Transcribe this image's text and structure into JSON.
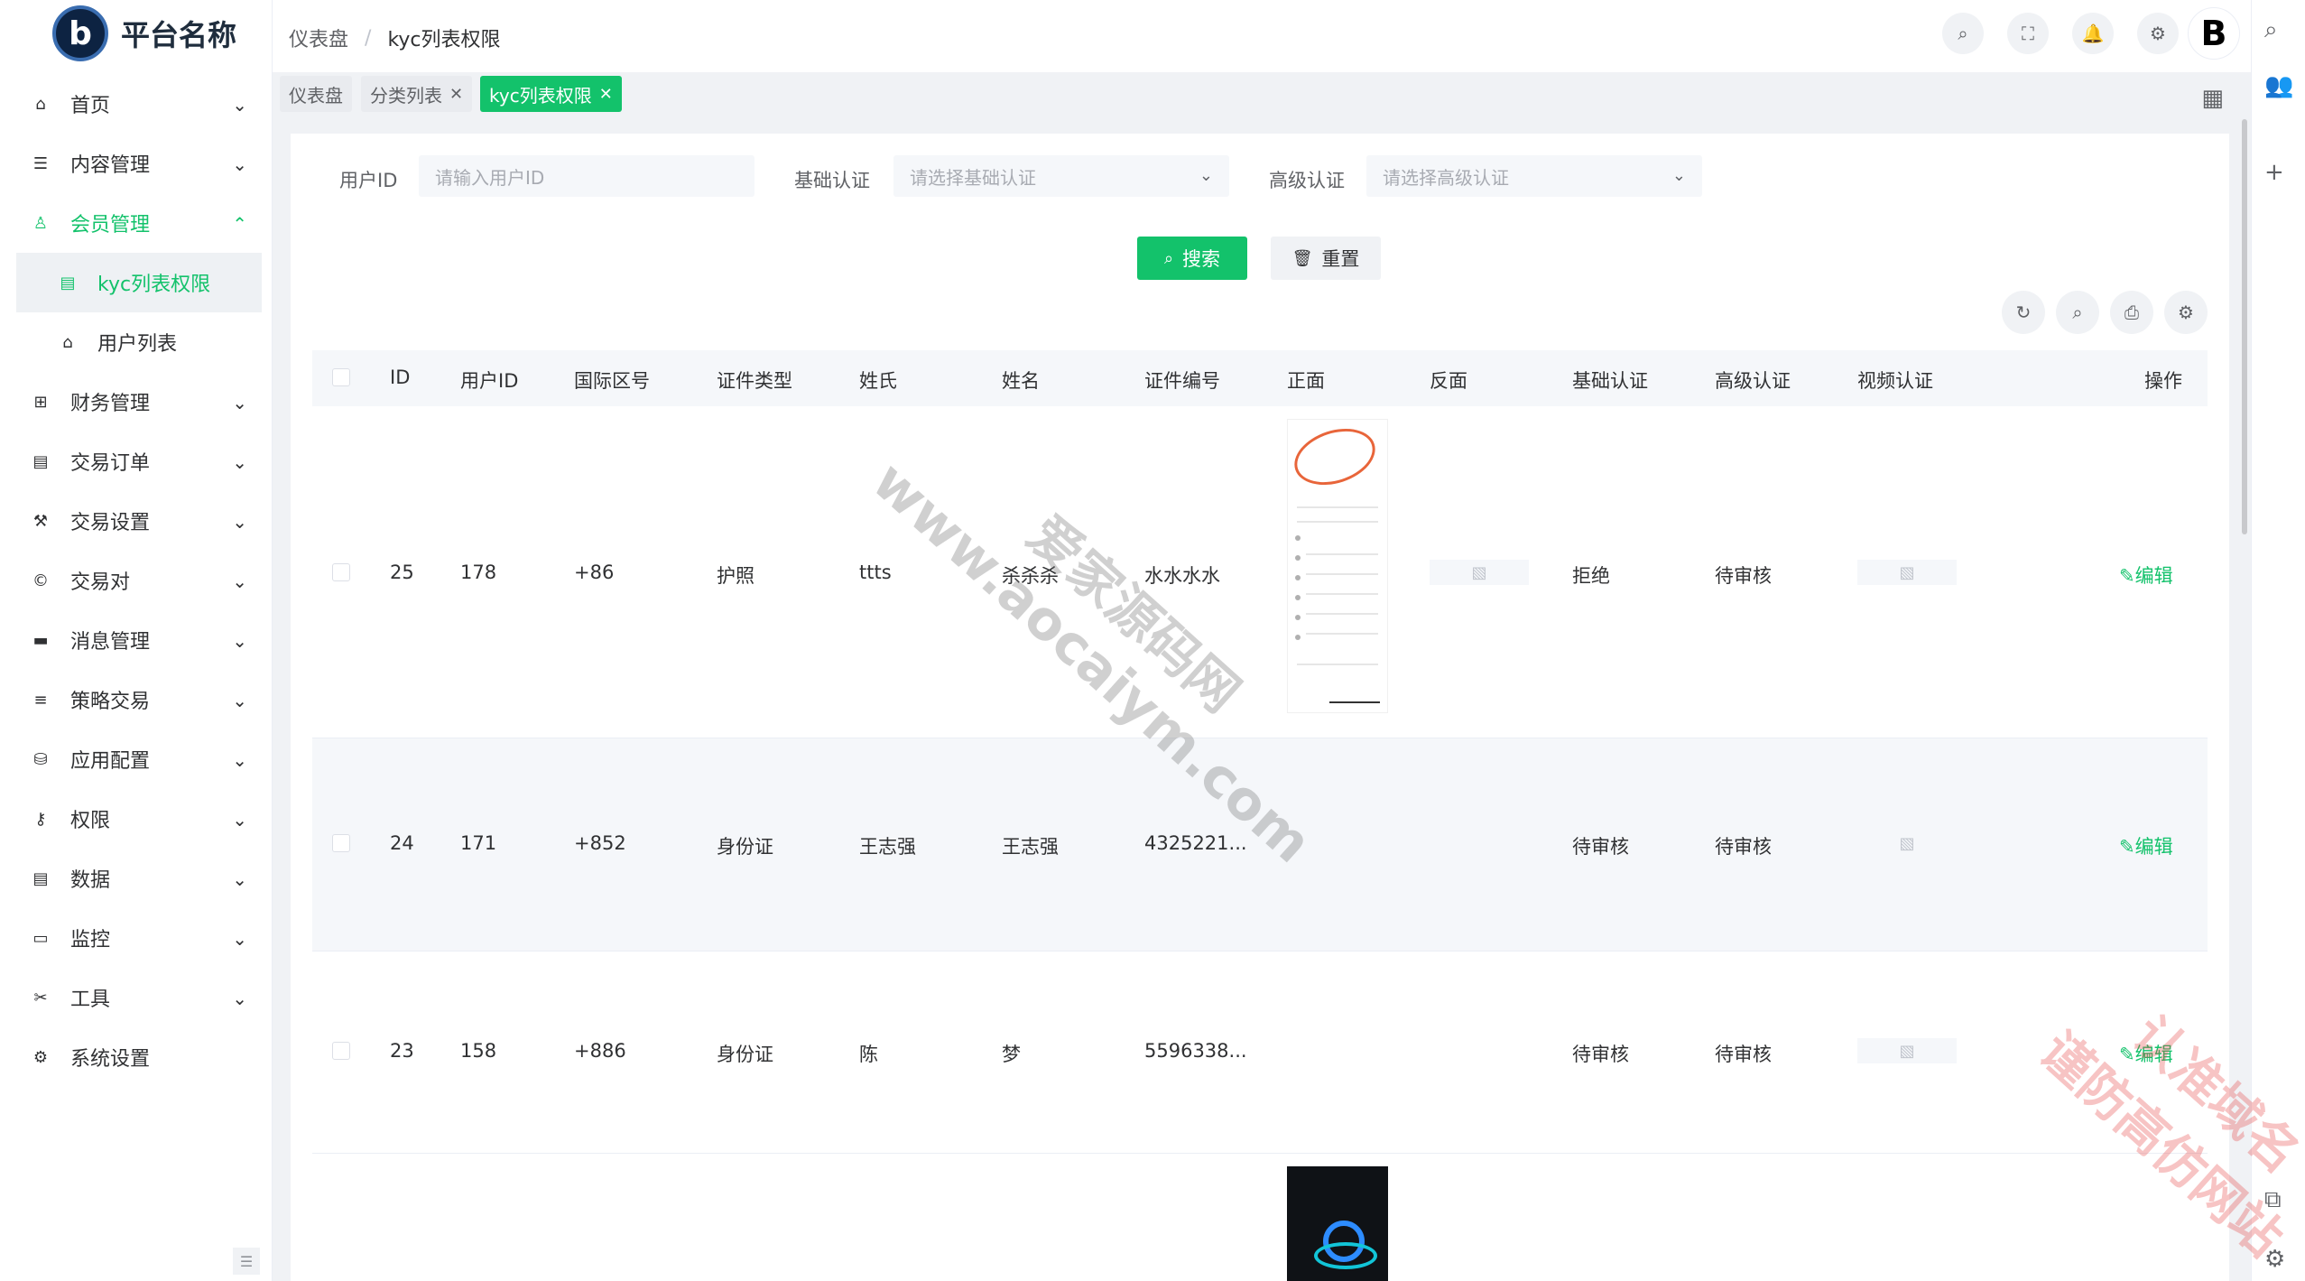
{
  "app": {
    "title": "平台名称",
    "logo_letter": "b"
  },
  "breadcrumb": [
    "仪表盘",
    "kyc列表权限"
  ],
  "sidebar": {
    "items": [
      {
        "label": "首页",
        "icon": "home-icon",
        "glyph": "⌂",
        "arrow": "⌄"
      },
      {
        "label": "内容管理",
        "icon": "list-icon",
        "glyph": "☰",
        "arrow": "⌄"
      },
      {
        "label": "会员管理",
        "icon": "user-icon",
        "glyph": "♙",
        "arrow": "⌃",
        "open": true
      },
      {
        "label": "kyc列表权限",
        "icon": "book-icon",
        "glyph": "▤",
        "sub": true,
        "active": true
      },
      {
        "label": "用户列表",
        "icon": "home-icon",
        "glyph": "⌂",
        "sub": true
      },
      {
        "label": "财务管理",
        "icon": "grid-icon",
        "glyph": "⊞",
        "arrow": "⌄"
      },
      {
        "label": "交易订单",
        "icon": "table-icon",
        "glyph": "▤",
        "arrow": "⌄"
      },
      {
        "label": "交易设置",
        "icon": "wrench-icon",
        "glyph": "⚒",
        "arrow": "⌄"
      },
      {
        "label": "交易对",
        "icon": "copyright-icon",
        "glyph": "©",
        "arrow": "⌄"
      },
      {
        "label": "消息管理",
        "icon": "message-icon",
        "glyph": "▬",
        "arrow": "⌄"
      },
      {
        "label": "策略交易",
        "icon": "menu-icon",
        "glyph": "≡",
        "arrow": "⌄"
      },
      {
        "label": "应用配置",
        "icon": "coins-icon",
        "glyph": "⛁",
        "arrow": "⌄"
      },
      {
        "label": "权限",
        "icon": "user-key-icon",
        "glyph": "⚷",
        "arrow": "⌄"
      },
      {
        "label": "数据",
        "icon": "database-icon",
        "glyph": "▤",
        "arrow": "⌄"
      },
      {
        "label": "监控",
        "icon": "monitor-icon",
        "glyph": "▭",
        "arrow": "⌄"
      },
      {
        "label": "工具",
        "icon": "tools-icon",
        "glyph": "✂",
        "arrow": "⌄"
      },
      {
        "label": "系统设置",
        "icon": "gear-icon",
        "glyph": "⚙"
      }
    ]
  },
  "tags": [
    {
      "label": "仪表盘",
      "closable": false
    },
    {
      "label": "分类列表",
      "closable": true
    },
    {
      "label": "kyc列表权限",
      "closable": true,
      "active": true
    }
  ],
  "filters": {
    "user_id_label": "用户ID",
    "user_id_placeholder": "请输入用户ID",
    "basic_label": "基础认证",
    "basic_placeholder": "请选择基础认证",
    "advanced_label": "高级认证",
    "advanced_placeholder": "请选择高级认证"
  },
  "buttons": {
    "search": "搜索",
    "reset": "重置",
    "search_glyph": "⌕",
    "reset_glyph": "🗑"
  },
  "table": {
    "columns": [
      "ID",
      "用户ID",
      "国际区号",
      "证件类型",
      "姓氏",
      "姓名",
      "证件编号",
      "正面",
      "反面",
      "基础认证",
      "高级认证",
      "视频认证",
      "操作"
    ],
    "rows": [
      {
        "id": "25",
        "user_id": "178",
        "area": "+86",
        "doc_type": "护照",
        "surname": "ttts",
        "name": "杀杀杀",
        "doc_no": "水水水水",
        "basic": "拒绝",
        "advanced": "待审核",
        "action": "编辑"
      },
      {
        "id": "24",
        "user_id": "171",
        "area": "+852",
        "doc_type": "身份证",
        "surname": "王志强",
        "name": "王志强",
        "doc_no": "4325221...",
        "basic": "待审核",
        "advanced": "待审核",
        "action": "编辑"
      },
      {
        "id": "23",
        "user_id": "158",
        "area": "+886",
        "doc_type": "身份证",
        "surname": "陈",
        "name": "梦",
        "doc_no": "5596338...",
        "basic": "待审核",
        "advanced": "待审核",
        "action": "编辑"
      },
      {
        "id": "",
        "user_id": "",
        "area": "",
        "doc_type": "",
        "surname": "",
        "name": "",
        "doc_no": "",
        "basic": "",
        "advanced": "",
        "action": ""
      }
    ]
  },
  "watermarks": [
    "爱家源码网",
    "www.aocaiym.com",
    "认准域名",
    "谨防高仿网站"
  ]
}
